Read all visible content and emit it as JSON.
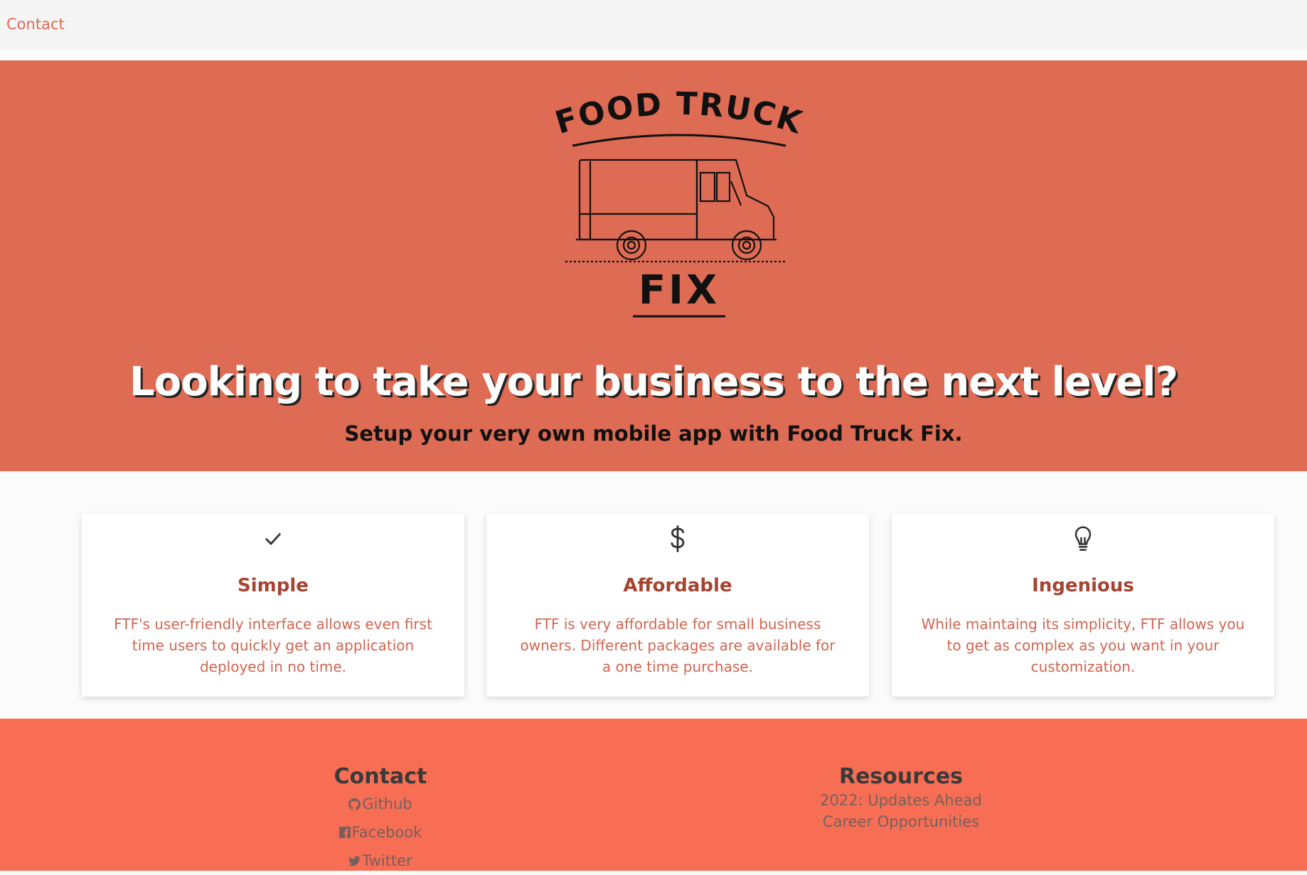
{
  "nav": {
    "contact_label": "Contact"
  },
  "hero": {
    "logo": {
      "line1": "FOOD TRUCK",
      "line2": "FIX"
    },
    "headline": "Looking to take your business to the next level?",
    "subheadline": "Setup your very own mobile app with Food Truck Fix."
  },
  "features": [
    {
      "icon": "check-icon",
      "title": "Simple",
      "text": "FTF's user-friendly interface allows even first time users to quickly get an application deployed in no time."
    },
    {
      "icon": "dollar-icon",
      "title": "Affordable",
      "text": "FTF is very affordable for small business owners. Different packages are available for a one time purchase."
    },
    {
      "icon": "lightbulb-icon",
      "title": "Ingenious",
      "text": "While maintaing its simplicity, FTF allows you to get as complex as you want in your customization."
    }
  ],
  "footer": {
    "contact": {
      "heading": "Contact",
      "links": [
        {
          "icon": "github-icon",
          "label": "Github"
        },
        {
          "icon": "facebook-icon",
          "label": "Facebook"
        },
        {
          "icon": "twitter-icon",
          "label": "Twitter"
        }
      ]
    },
    "resources": {
      "heading": "Resources",
      "links": [
        {
          "label": "2022: Updates Ahead"
        },
        {
          "label": "Career Opportunities"
        }
      ]
    }
  },
  "colors": {
    "accent": "#de6b53",
    "footer": "#f76e54",
    "card_title": "#a44431",
    "card_text": "#d2654f"
  }
}
